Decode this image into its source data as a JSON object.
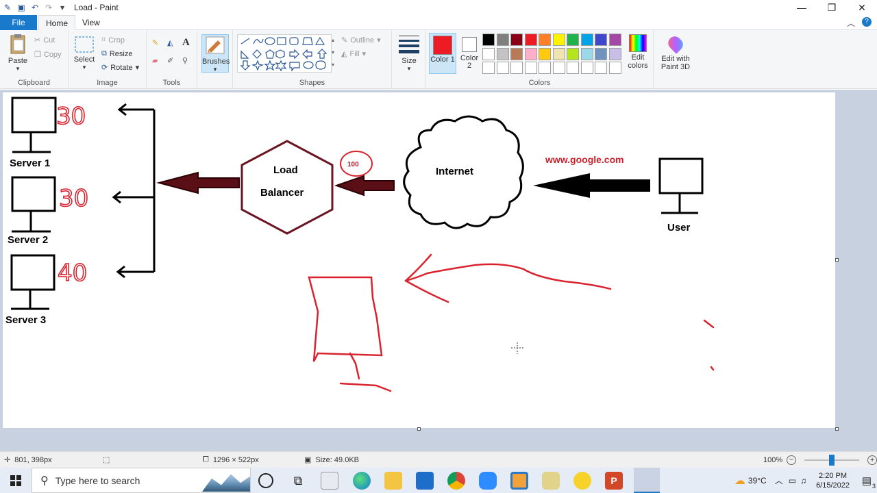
{
  "app": {
    "title": "Load - Paint"
  },
  "window_controls": {
    "minimize": "—",
    "maximize": "❐",
    "close": "✕"
  },
  "tabs": {
    "file": "File",
    "home": "Home",
    "view": "View"
  },
  "ribbon": {
    "clipboard": {
      "label": "Clipboard",
      "paste": "Paste",
      "cut": "Cut",
      "copy": "Copy"
    },
    "image": {
      "label": "Image",
      "select": "Select",
      "crop": "Crop",
      "resize": "Resize",
      "rotate": "Rotate"
    },
    "tools": {
      "label": "Tools"
    },
    "brushes": {
      "label": "Brushes"
    },
    "shapes": {
      "label": "Shapes",
      "outline": "Outline",
      "fill": "Fill"
    },
    "size": {
      "label": "Size"
    },
    "colors": {
      "label": "Colors",
      "color1": "Color 1",
      "color2": "Color 2",
      "color1_value": "#ed1c24",
      "color2_value": "#ffffff",
      "edit_colors": "Edit colors",
      "row1": [
        "#000000",
        "#7f7f7f",
        "#880015",
        "#ed1c24",
        "#ff7f27",
        "#fff200",
        "#22b14c",
        "#00a2e8",
        "#3f48cc",
        "#a349a4"
      ],
      "row2": [
        "#ffffff",
        "#c3c3c3",
        "#b97a57",
        "#ffaec9",
        "#ffc90e",
        "#efe4b0",
        "#b5e61d",
        "#99d9ea",
        "#7092be",
        "#c8bfe7"
      ],
      "row3": [
        "#ffffff",
        "#ffffff",
        "#ffffff",
        "#ffffff",
        "#ffffff",
        "#ffffff",
        "#ffffff",
        "#ffffff",
        "#ffffff",
        "#ffffff"
      ]
    },
    "paint3d": {
      "label": "Edit with Paint 3D"
    }
  },
  "drawing": {
    "servers": [
      "Server 1",
      "Server 2",
      "Server 3"
    ],
    "counts": [
      "30",
      "30",
      "40"
    ],
    "load_balancer": [
      "Load",
      "Balancer"
    ],
    "internet": "Internet",
    "url": "www.google.com",
    "user": "User",
    "bubble": "100"
  },
  "status": {
    "cursor": "801, 398px",
    "dimensions": "1296 × 522px",
    "filesize": "Size: 49.0KB",
    "zoom": "100%"
  },
  "taskbar": {
    "search_placeholder": "Type here to search",
    "temperature": "39°C",
    "time": "2:20 PM",
    "date": "6/15/2022",
    "notifications": "3"
  }
}
